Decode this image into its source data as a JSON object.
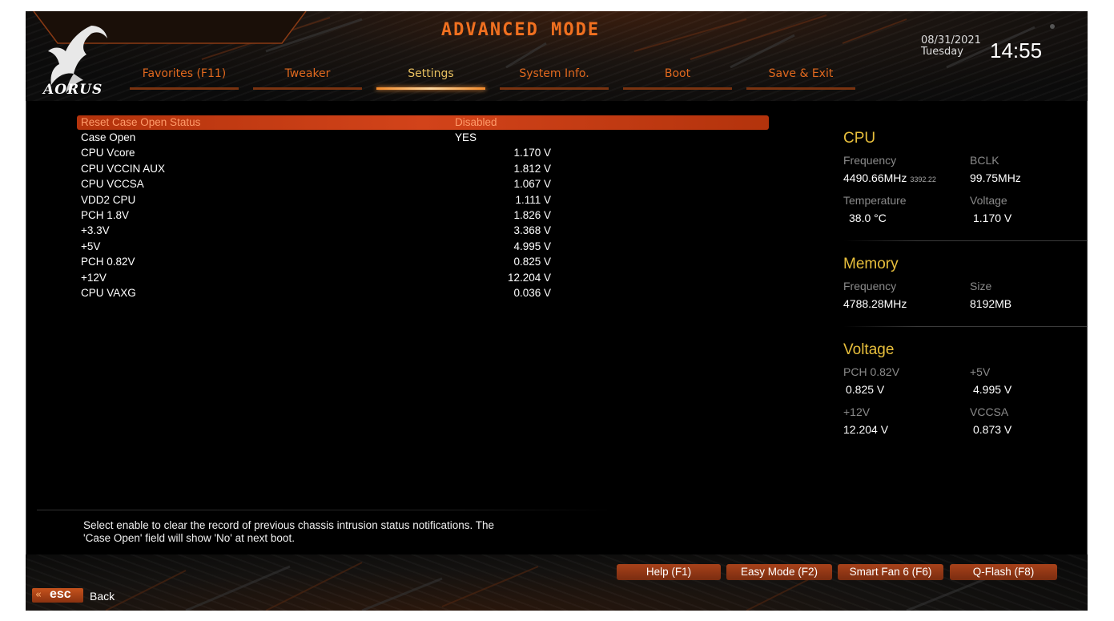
{
  "header": {
    "mode_title": "ADVANCED MODE",
    "brand": "AORUS",
    "date": "08/31/2021",
    "weekday": "Tuesday",
    "time": "14:55"
  },
  "tabs": [
    {
      "label": "Favorites (F11)",
      "active": false
    },
    {
      "label": "Tweaker",
      "active": false
    },
    {
      "label": "Settings",
      "active": true
    },
    {
      "label": "System Info.",
      "active": false
    },
    {
      "label": "Boot",
      "active": false
    },
    {
      "label": "Save & Exit",
      "active": false
    }
  ],
  "settings": [
    {
      "name": "Reset Case Open Status",
      "value": "Disabled"
    },
    {
      "name": "Case Open",
      "value": "YES"
    },
    {
      "name": "CPU Vcore",
      "value": "1.170 V"
    },
    {
      "name": "CPU VCCIN AUX",
      "value": "1.812 V"
    },
    {
      "name": "CPU VCCSA",
      "value": "1.067 V"
    },
    {
      "name": "VDD2 CPU",
      "value": "1.111 V"
    },
    {
      "name": "PCH 1.8V",
      "value": "1.826 V"
    },
    {
      "name": "+3.3V",
      "value": "3.368 V"
    },
    {
      "name": "+5V",
      "value": "4.995 V"
    },
    {
      "name": "PCH 0.82V",
      "value": "0.825 V"
    },
    {
      "name": "+12V",
      "value": "12.204 V"
    },
    {
      "name": "CPU VAXG",
      "value": "0.036 V"
    }
  ],
  "panel": {
    "cpu": {
      "title": "CPU",
      "frequency_label": "Frequency",
      "frequency_value": "4490.66MHz",
      "frequency_sub": "3392.22",
      "bclk_label": "BCLK",
      "bclk_value": "99.75MHz",
      "temperature_label": "Temperature",
      "temperature_value": "38.0 °C",
      "voltage_label": "Voltage",
      "voltage_value": "1.170 V"
    },
    "memory": {
      "title": "Memory",
      "frequency_label": "Frequency",
      "frequency_value": "4788.28MHz",
      "size_label": "Size",
      "size_value": "8192MB"
    },
    "voltage": {
      "title": "Voltage",
      "pch_label": "PCH 0.82V",
      "pch_value": "0.825 V",
      "p5v_label": "+5V",
      "p5v_value": "4.995 V",
      "p12v_label": "+12V",
      "p12v_value": "12.204 V",
      "vccsa_label": "VCCSA",
      "vccsa_value": "0.873 V"
    }
  },
  "help": {
    "line1": "Select enable to clear the record of previous chassis intrusion status notifications. The",
    "line2": "'Case Open' field will show 'No' at next boot."
  },
  "footer": {
    "fkeys": [
      "Help (F1)",
      "Easy Mode (F2)",
      "Smart Fan 6 (F6)",
      "Q-Flash (F8)"
    ],
    "esc_label": "esc",
    "back_label": "Back"
  },
  "colors": {
    "accent_orange": "#e0681e",
    "title_orange": "#f07020",
    "section_gold": "#e8bf3c",
    "selected_row": "#c23b12"
  }
}
